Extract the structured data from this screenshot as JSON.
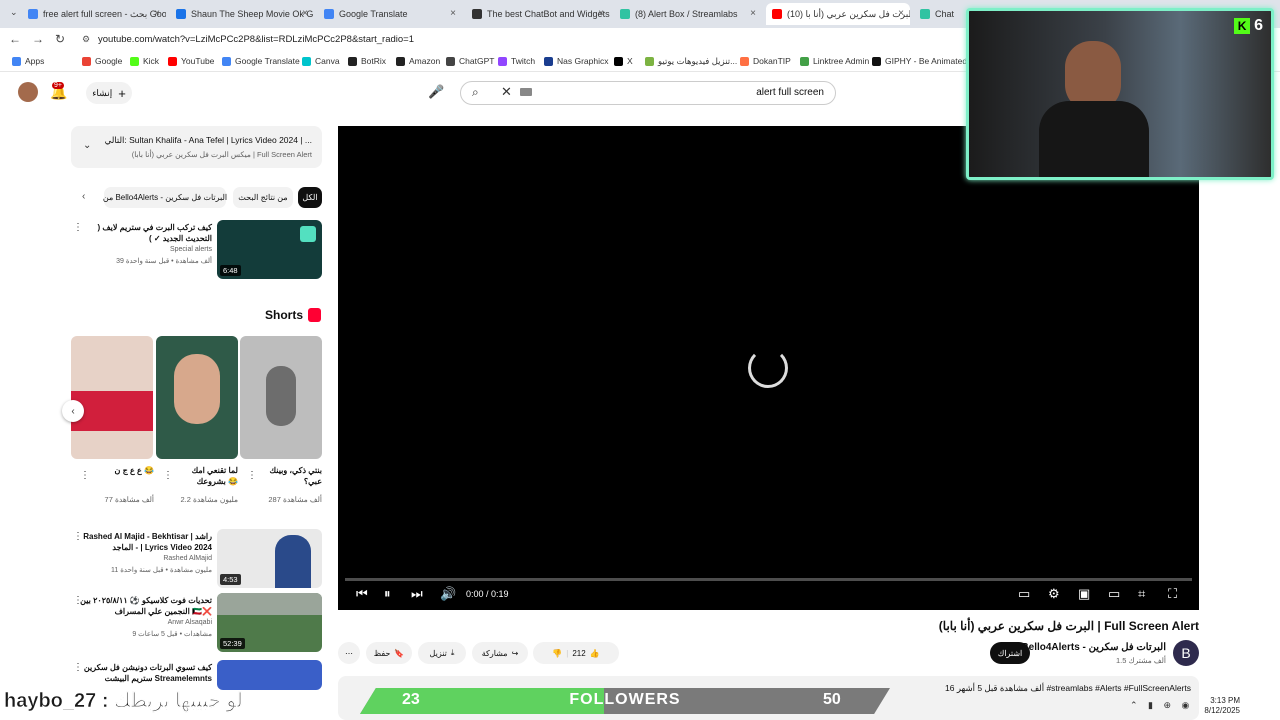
{
  "browser": {
    "tabs": [
      {
        "title": "free alert full screen - بحث Goo",
        "color": "#4285f4",
        "active": false
      },
      {
        "title": "Shaun The Sheep Movie Ok Gli",
        "color": "#1a73e8",
        "active": false
      },
      {
        "title": "Google Translate",
        "color": "#4285f4",
        "active": false
      },
      {
        "title": "The best ChatBot and Widgets",
        "color": "#333333",
        "active": false
      },
      {
        "title": "(8) Alert Box / Streamlabs",
        "color": "#31c3a2",
        "active": false
      },
      {
        "title": "(10) البرت فل سكرين عربي (أنا با",
        "color": "#ff0000",
        "active": true
      },
      {
        "title": "Chat",
        "color": "#31c3a2",
        "active": false
      }
    ],
    "url": "youtube.com/watch?v=LziMcPCc2P8&list=RDLziMcPCc2P8&start_radio=1",
    "bookmarks": [
      {
        "label": "Apps",
        "color": "#4285f4"
      },
      {
        "label": "Google",
        "color": "#ea4335"
      },
      {
        "label": "Kick",
        "color": "#53fc18"
      },
      {
        "label": "YouTube",
        "color": "#ff0000"
      },
      {
        "label": "Google Translate",
        "color": "#4285f4"
      },
      {
        "label": "Canva",
        "color": "#00c4cc"
      },
      {
        "label": "BotRix",
        "color": "#222222"
      },
      {
        "label": "Amazon",
        "color": "#222222"
      },
      {
        "label": "ChatGPT",
        "color": "#444444"
      },
      {
        "label": "Twitch",
        "color": "#9146ff"
      },
      {
        "label": "Nas Graphicx",
        "color": "#1a3d8f"
      },
      {
        "label": "X",
        "color": "#000000"
      },
      {
        "label": "تنزيل فيديوهات يوتيو...",
        "color": "#7cb342"
      },
      {
        "label": "DokanTIP",
        "color": "#ff7043"
      },
      {
        "label": "Linktree Admin",
        "color": "#43a047"
      },
      {
        "label": "GIPHY - Be Animated",
        "color": "#111111"
      }
    ]
  },
  "header": {
    "notif_count": "9+",
    "create_label": "إنشاء",
    "search_query": "alert full screen"
  },
  "sidebar": {
    "next_up_title": "التالي: Sultan Khalifa - Ana Tefel | Lyrics Video 2024 | ...",
    "next_up_sub": "ميكس البرت فل سكرين عربي (أنا بابا) | Full Screen Alert",
    "chips": [
      {
        "label": "الكل",
        "active": true
      },
      {
        "label": "من نتائج البحث",
        "active": false
      },
      {
        "label": "من Bello4Alerts - البرتات فل سكرين",
        "active": false
      }
    ],
    "videos": [
      {
        "title": "كيف تركب البرت في ستريم لايف ( التحديث الجديد ✓ )",
        "channel": "Special alerts",
        "meta": "39 ألف مشاهدة • قبل سنة واحدة",
        "duration": "6:48",
        "thumb": "#133c3a"
      },
      {
        "title": "Rashed Al Majid - Bekhtisar | راشد الماجد - | Lyrics Video 2024",
        "channel": "Rashed AlMajid",
        "meta": "11 مليون مشاهدة • قبل سنة واحدة",
        "duration": "4:53",
        "thumb": "#e9e9e9"
      },
      {
        "title": "تحديات فوت كلاسيكو ⚽ ٢٠٢٥/٨/١١ بين النجمين علي المسراف 🇰🇼❌",
        "channel": "Anwr Alsaqabi",
        "meta": "9 مشاهدات • قبل 5 ساعات",
        "duration": "52:39",
        "thumb": "#4f7a4a"
      },
      {
        "title": "كيف تسوي البرتات دونيشن فل سكرين ستريم البيشت Streamelemnts",
        "channel": "",
        "meta": "",
        "duration": "",
        "thumb": "#3a5fc8"
      }
    ],
    "shorts_title": "Shorts",
    "shorts": [
      {
        "title": "بنتي ذكي، وبينك عبي؟",
        "views": "287 ألف مشاهدة",
        "color": "#b9b9b9"
      },
      {
        "title": "لما تقنعي امك بشروعك 😂",
        "views": "2.2 مليون مشاهدة",
        "color": "#2f5a48"
      },
      {
        "title": "ع ع ج ن 😂",
        "views": "77 ألف مشاهدة",
        "color": "#d6b9a8"
      }
    ]
  },
  "player": {
    "time": "0:00 / 0:19",
    "progress": 0
  },
  "video": {
    "title": "البرت فل سكرين عربي (أنا بابا) | Full Screen Alert",
    "channel": "Bello4Alerts - البرتات فل سكرين",
    "subs": "1.5 ألف مشترك",
    "subscribe": "اشتراك",
    "likes": "212",
    "share": "مشاركة",
    "download": "تنزيل",
    "save": "حفظ",
    "description_meta": "16 ألف مشاهدة  قبل 5 أشهر  #streamlabs #Alerts #FullScreenAlerts"
  },
  "webcam": {
    "viewers": "6"
  },
  "stream_overlay": {
    "name": "haybo_27 : لو حبيبها بربطك",
    "followers_current": "23",
    "followers_label": "FOLLOWERS",
    "followers_goal": "50",
    "progress": 0.46
  },
  "taskbar": {
    "time": "3:13 PM",
    "date": "8/12/2025"
  }
}
